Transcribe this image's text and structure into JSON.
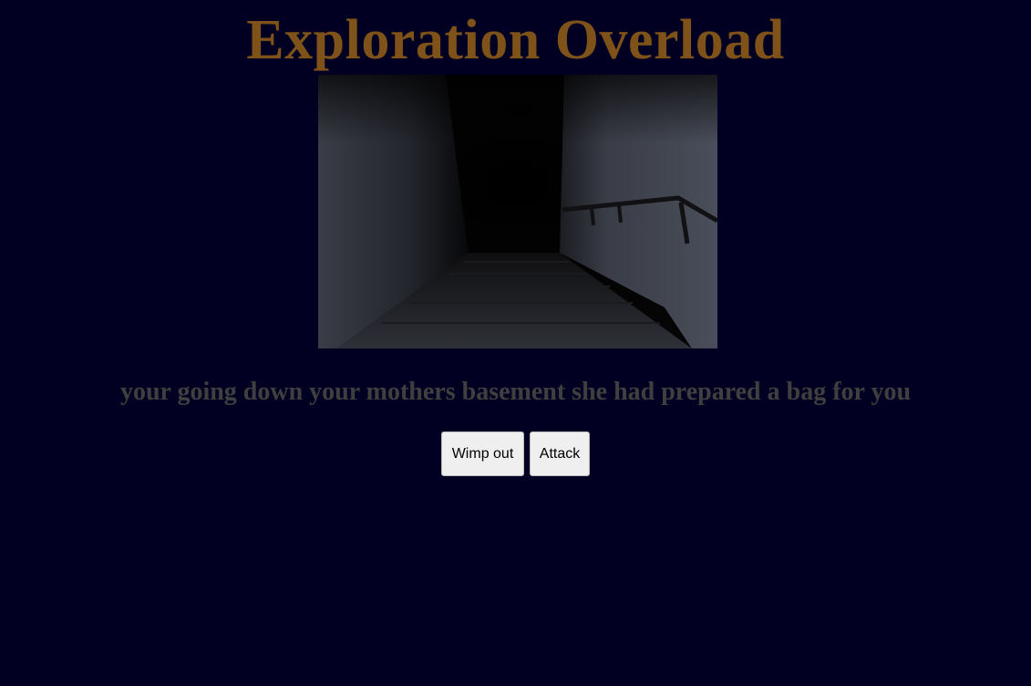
{
  "game": {
    "title": "Exploration Overload",
    "scene_image": "dark-basement-stairs",
    "story_text": "your going down your mothers basement she had prepared a bag for you",
    "choices": [
      {
        "label": "Wimp out"
      },
      {
        "label": "Attack"
      }
    ]
  },
  "colors": {
    "background": "#020022",
    "title": "#7f5219",
    "story_text": "#3f3f3f",
    "button_bg": "#efefef"
  }
}
